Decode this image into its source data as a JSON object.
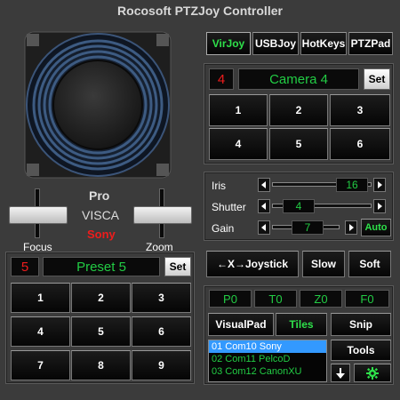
{
  "window": {
    "title": "Rocosoft PTZJoy Controller"
  },
  "tabs": [
    {
      "label": "VirJoy",
      "active": true
    },
    {
      "label": "USBJoy",
      "active": false
    },
    {
      "label": "HotKeys",
      "active": false
    },
    {
      "label": "PTZPad",
      "active": false
    }
  ],
  "camera": {
    "number": "4",
    "name": "Camera 4",
    "set_label": "Set",
    "buttons": [
      "1",
      "2",
      "3",
      "4",
      "5",
      "6"
    ]
  },
  "joystick": {
    "pro_label": "Pro",
    "protocol": "VISCA",
    "brand": "Sony",
    "focus_label": "Focus",
    "zoom_label": "Zoom"
  },
  "preset": {
    "number": "5",
    "name": "Preset 5",
    "set_label": "Set",
    "buttons": [
      "1",
      "2",
      "3",
      "4",
      "5",
      "6",
      "7",
      "8",
      "9"
    ]
  },
  "controls": {
    "iris": {
      "label": "Iris",
      "value": "16",
      "level": 0.85
    },
    "shutter": {
      "label": "Shutter",
      "value": "4",
      "level": 0.2
    },
    "gain": {
      "label": "Gain",
      "value": "7",
      "level": 0.55
    },
    "auto_label": "Auto"
  },
  "actions": {
    "joystick_label": "←X→Joystick",
    "slow_label": "Slow",
    "soft_label": "Soft"
  },
  "readouts": [
    "P0",
    "T0",
    "Z0",
    "F0"
  ],
  "bottom": {
    "visualpad_label": "VisualPad",
    "tiles_label": "Tiles",
    "snip_label": "Snip",
    "tools_label": "Tools"
  },
  "ports": [
    {
      "label": "01 Com10 Sony",
      "selected": true
    },
    {
      "label": "02 Com11 PelcoD",
      "selected": false
    },
    {
      "label": "03 Com12 CanonXU",
      "selected": false
    }
  ],
  "icons": {
    "down": "download-arrow-icon",
    "gear": "gear-icon"
  },
  "colors": {
    "accent_green": "#22cc44",
    "accent_red": "#ee1c1c",
    "selection_blue": "#3399ff"
  }
}
